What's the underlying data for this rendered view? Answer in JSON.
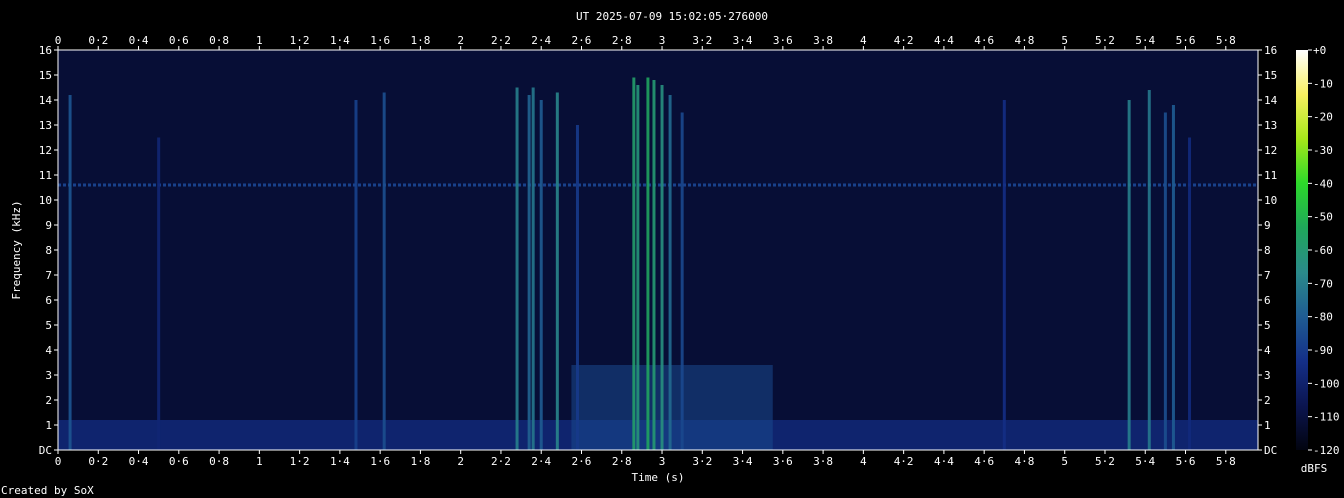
{
  "chart_data": {
    "type": "heatmap",
    "title": "UT 2025-07-09 15:02:05·276000",
    "xlabel": "Time (s)",
    "ylabel": "Frequency (kHz)",
    "colorbar_label": "dBFS",
    "xlim": [
      0,
      5.96
    ],
    "ylim": [
      0,
      16
    ],
    "x_ticks": [
      "0",
      "0·2",
      "0·4",
      "0·6",
      "0·8",
      "1",
      "1·2",
      "1·4",
      "1·6",
      "1·8",
      "2",
      "2·2",
      "2·4",
      "2·6",
      "2·8",
      "3",
      "3·2",
      "3·4",
      "3·6",
      "3·8",
      "4",
      "4·2",
      "4·4",
      "4·6",
      "4·8",
      "5",
      "5·2",
      "5·4",
      "5·6",
      "5·8"
    ],
    "y_ticks": [
      "DC",
      "1",
      "2",
      "3",
      "4",
      "5",
      "6",
      "7",
      "8",
      "9",
      "10",
      "11",
      "12",
      "13",
      "14",
      "15",
      "16"
    ],
    "colorbar_ticks": [
      "+0",
      "-10",
      "-20",
      "-30",
      "-40",
      "-50",
      "-60",
      "-70",
      "-80",
      "-90",
      "-100",
      "-110",
      "-120"
    ],
    "colorbar_range": [
      -120,
      0
    ],
    "colormap": [
      "#ffffff",
      "#f8f060",
      "#a6e81a",
      "#2cd82a",
      "#1fa85a",
      "#2a8a8a",
      "#1f5c92",
      "#142f88",
      "#0b1550",
      "#02040f"
    ],
    "background_noise_dbfs": -112,
    "horizontal_tone": {
      "freq_khz": 10.6,
      "level_dbfs": -88
    },
    "low_band": {
      "freq_max_khz": 1.2,
      "level_dbfs": -95
    },
    "transients": [
      {
        "t": 0.06,
        "f_top_khz": 14.2,
        "level_dbfs": -82
      },
      {
        "t": 0.5,
        "f_top_khz": 12.5,
        "level_dbfs": -98
      },
      {
        "t": 1.48,
        "f_top_khz": 14.0,
        "level_dbfs": -88
      },
      {
        "t": 1.62,
        "f_top_khz": 14.3,
        "level_dbfs": -84
      },
      {
        "t": 2.28,
        "f_top_khz": 14.5,
        "level_dbfs": -70
      },
      {
        "t": 2.34,
        "f_top_khz": 14.2,
        "level_dbfs": -78
      },
      {
        "t": 2.36,
        "f_top_khz": 14.5,
        "level_dbfs": -72
      },
      {
        "t": 2.4,
        "f_top_khz": 14.0,
        "level_dbfs": -80
      },
      {
        "t": 2.48,
        "f_top_khz": 14.3,
        "level_dbfs": -68
      },
      {
        "t": 2.58,
        "f_top_khz": 13.0,
        "level_dbfs": -90
      },
      {
        "t": 2.86,
        "f_top_khz": 14.9,
        "level_dbfs": -58
      },
      {
        "t": 2.88,
        "f_top_khz": 14.6,
        "level_dbfs": -62
      },
      {
        "t": 2.93,
        "f_top_khz": 14.9,
        "level_dbfs": -55
      },
      {
        "t": 2.96,
        "f_top_khz": 14.8,
        "level_dbfs": -60
      },
      {
        "t": 3.0,
        "f_top_khz": 14.6,
        "level_dbfs": -64
      },
      {
        "t": 3.04,
        "f_top_khz": 14.2,
        "level_dbfs": -76
      },
      {
        "t": 3.1,
        "f_top_khz": 13.5,
        "level_dbfs": -86
      },
      {
        "t": 4.7,
        "f_top_khz": 14.0,
        "level_dbfs": -94
      },
      {
        "t": 5.32,
        "f_top_khz": 14.0,
        "level_dbfs": -70
      },
      {
        "t": 5.42,
        "f_top_khz": 14.4,
        "level_dbfs": -72
      },
      {
        "t": 5.5,
        "f_top_khz": 13.5,
        "level_dbfs": -84
      },
      {
        "t": 5.54,
        "f_top_khz": 13.8,
        "level_dbfs": -80
      },
      {
        "t": 5.62,
        "f_top_khz": 12.5,
        "level_dbfs": -96
      }
    ],
    "tonal_block": {
      "t_start": 2.55,
      "t_end": 3.55,
      "f_max_khz": 3.4,
      "level_dbfs": -86
    }
  },
  "footer": {
    "credit": "Created by SoX"
  }
}
